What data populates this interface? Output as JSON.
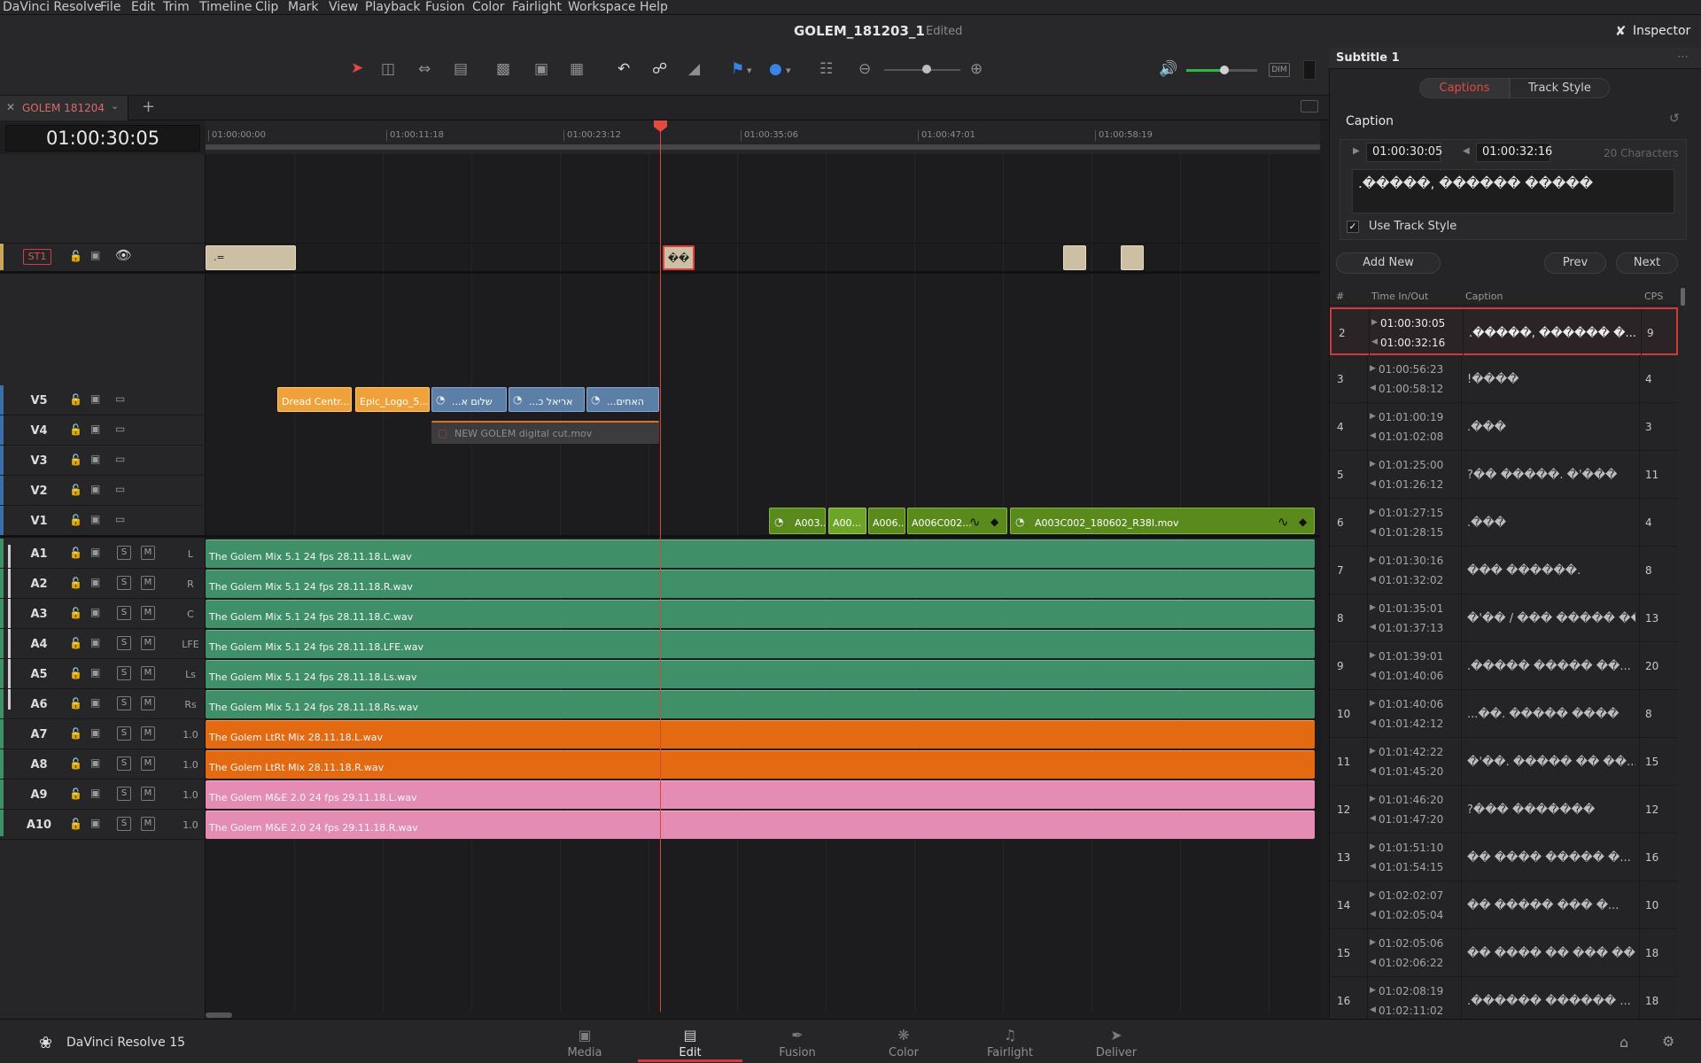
{
  "menu": {
    "app": "DaVinci Resolve",
    "items": [
      "File",
      "Edit",
      "Trim",
      "Timeline",
      "Clip",
      "Mark",
      "View",
      "Playback",
      "Fusion",
      "Color",
      "Fairlight",
      "Workspace",
      "Help"
    ]
  },
  "project": {
    "title": "GOLEM_181203_1",
    "status": "Edited"
  },
  "inspector_button": "Inspector",
  "timeline": {
    "tab_name": "GOLEM 181204",
    "timecode": "01:00:30:05",
    "ruler": [
      "01:00:00:00",
      "01:00:11:18",
      "01:00:23:12",
      "01:00:35:06",
      "01:00:47:01",
      "01:00:58:19"
    ]
  },
  "tracks": {
    "subtitle": {
      "name": "ST1"
    },
    "video": [
      {
        "name": "V5"
      },
      {
        "name": "V4"
      },
      {
        "name": "V3"
      },
      {
        "name": "V2"
      },
      {
        "name": "V1"
      }
    ],
    "audio": [
      {
        "name": "A1",
        "channel": "L",
        "clip": "The Golem Mix 5.1 24 fps 28.11.18.L.wav"
      },
      {
        "name": "A2",
        "channel": "R",
        "clip": "The Golem Mix 5.1 24 fps 28.11.18.R.wav"
      },
      {
        "name": "A3",
        "channel": "C",
        "clip": "The Golem Mix 5.1 24 fps 28.11.18.C.wav"
      },
      {
        "name": "A4",
        "channel": "LFE",
        "clip": "The Golem Mix 5.1 24 fps 28.11.18.LFE.wav"
      },
      {
        "name": "A5",
        "channel": "Ls",
        "clip": "The Golem Mix 5.1 24 fps 28.11.18.Ls.wav"
      },
      {
        "name": "A6",
        "channel": "Rs",
        "clip": "The Golem Mix 5.1 24 fps 28.11.18.Rs.wav"
      },
      {
        "name": "A7",
        "channel": "1.0",
        "clip": "The Golem LtRt Mix 28.11.18.L.wav"
      },
      {
        "name": "A8",
        "channel": "1.0",
        "clip": "The Golem LtRt Mix 28.11.18.R.wav"
      },
      {
        "name": "A9",
        "channel": "1.0",
        "clip": "The Golem M&E 2.0 24 fps 29.11.18.L.wav"
      },
      {
        "name": "A10",
        "channel": "1.0",
        "clip": "The Golem M&E 2.0 24 fps 29.11.18.R.wav"
      }
    ],
    "solo_label": "S",
    "mute_label": "M"
  },
  "clips": {
    "subtitle": [
      ".=",
      "��"
    ],
    "v5": [
      "Dread Centr...",
      "Epic_Logo_5...",
      "...שלום א",
      "...אריאל כ",
      "...האחים"
    ],
    "v4": "NEW GOLEM digital cut.mov",
    "v1": [
      "A003...",
      "A00...",
      "A006...",
      "A006C002...",
      "A003C002_180602_R38I.mov"
    ]
  },
  "inspector": {
    "header": "Subtitle 1",
    "tabs": [
      "Captions",
      "Track Style"
    ],
    "active_tab": "Captions",
    "section": "Caption",
    "time_in": "01:00:30:05",
    "time_out": "01:00:32:16",
    "char_count": "20 Characters",
    "caption_text": ".�����, ������ �����",
    "use_track_style": "Use Track Style",
    "buttons": {
      "add": "Add New",
      "prev": "Prev",
      "next": "Next"
    },
    "list_headers": [
      "#",
      "Time In/Out",
      "Caption",
      "CPS"
    ],
    "rows": [
      {
        "n": "2",
        "tin": "01:00:30:05",
        "tout": "01:00:32:16",
        "cap": ".�����, ������ �...",
        "cps": "9"
      },
      {
        "n": "3",
        "tin": "01:00:56:23",
        "tout": "01:00:58:12",
        "cap": "!����",
        "cps": "4"
      },
      {
        "n": "4",
        "tin": "01:01:00:19",
        "tout": "01:01:02:08",
        "cap": ".���",
        "cps": "3"
      },
      {
        "n": "5",
        "tin": "01:01:25:00",
        "tout": "01:01:26:12",
        "cap": "?�� �����. �'���",
        "cps": "11"
      },
      {
        "n": "6",
        "tin": "01:01:27:15",
        "tout": "01:01:28:15",
        "cap": ".���",
        "cps": "4"
      },
      {
        "n": "7",
        "tin": "01:01:30:16",
        "tout": "01:01:32:02",
        "cap": "��� ������.",
        "cps": "8"
      },
      {
        "n": "8",
        "tin": "01:01:35:01",
        "tout": "01:01:37:13",
        "cap": "�'�� / ��� ����� ����...",
        "cps": "13"
      },
      {
        "n": "9",
        "tin": "01:01:39:01",
        "tout": "01:01:40:06",
        "cap": ".����� ����� ��...",
        "cps": "20"
      },
      {
        "n": "10",
        "tin": "01:01:40:06",
        "tout": "01:01:42:12",
        "cap": "...��. ����� ����",
        "cps": "8"
      },
      {
        "n": "11",
        "tin": "01:01:42:22",
        "tout": "01:01:45:20",
        "cap": "�'��. ����� �� ��...",
        "cps": "15"
      },
      {
        "n": "12",
        "tin": "01:01:46:20",
        "tout": "01:01:47:20",
        "cap": "?��� �������",
        "cps": "12"
      },
      {
        "n": "13",
        "tin": "01:01:51:10",
        "tout": "01:01:54:15",
        "cap": "�� ���� ����� �...",
        "cps": "16"
      },
      {
        "n": "14",
        "tin": "01:02:02:07",
        "tout": "01:02:05:04",
        "cap": "�� ����� ��� �...",
        "cps": "10"
      },
      {
        "n": "15",
        "tin": "01:02:05:06",
        "tout": "01:02:06:22",
        "cap": "�� ���� �� ��� �� / .����� ����",
        "cps": "18"
      },
      {
        "n": "16",
        "tin": "01:02:08:19",
        "tout": "01:02:11:02",
        "cap": ".������ ������ ...",
        "cps": "18"
      }
    ]
  },
  "footer": {
    "brand": "DaVinci Resolve 15",
    "pages": [
      "Media",
      "Edit",
      "Fusion",
      "Color",
      "Fairlight",
      "Deliver"
    ],
    "active_page": "Edit"
  },
  "colors": {
    "accent": "#d03a3a",
    "audio_green": "#3f9068",
    "audio_orange": "#e36a10",
    "audio_pink": "#e48cb4",
    "video_gold": "#f0a23a",
    "video_blue": "#5c7fa7",
    "video_green": "#5a8a1c"
  }
}
